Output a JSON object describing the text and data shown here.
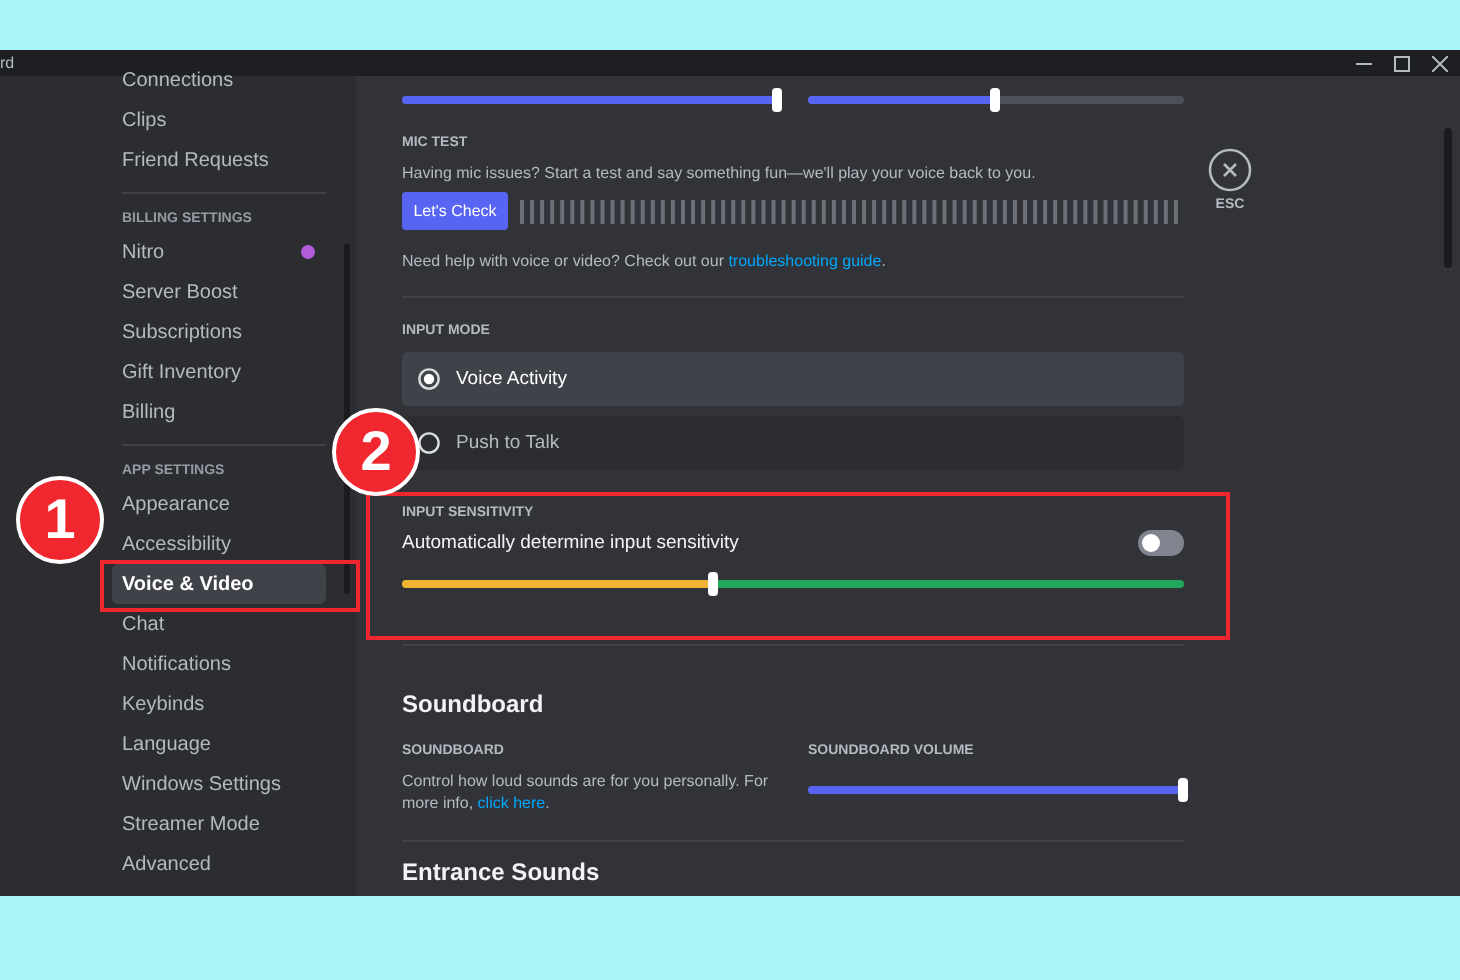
{
  "window": {
    "title": "rd"
  },
  "sidebar": {
    "sections": [
      {
        "items": [
          {
            "label": "Connections",
            "selected": false
          },
          {
            "label": "Clips",
            "selected": false
          },
          {
            "label": "Friend Requests",
            "selected": false
          }
        ]
      },
      {
        "header": "BILLING SETTINGS",
        "items": [
          {
            "label": "Nitro",
            "selected": false,
            "badge": true
          },
          {
            "label": "Server Boost",
            "selected": false
          },
          {
            "label": "Subscriptions",
            "selected": false
          },
          {
            "label": "Gift Inventory",
            "selected": false
          },
          {
            "label": "Billing",
            "selected": false
          }
        ]
      },
      {
        "header": "APP SETTINGS",
        "items": [
          {
            "label": "Appearance",
            "selected": false
          },
          {
            "label": "Accessibility",
            "selected": false
          },
          {
            "label": "Voice & Video",
            "selected": true
          },
          {
            "label": "Chat",
            "selected": false
          },
          {
            "label": "Notifications",
            "selected": false
          },
          {
            "label": "Keybinds",
            "selected": false
          },
          {
            "label": "Language",
            "selected": false
          },
          {
            "label": "Windows Settings",
            "selected": false
          },
          {
            "label": "Streamer Mode",
            "selected": false
          },
          {
            "label": "Advanced",
            "selected": false
          }
        ]
      }
    ]
  },
  "content": {
    "top_sliders": [
      {
        "level": 1
      },
      {
        "level": 0.5
      }
    ],
    "mic_test": {
      "heading": "MIC TEST",
      "description": "Having mic issues? Start a test and say something fun—we'll play your voice back to you.",
      "button": "Let's Check",
      "help_text": "Need help with voice or video? Check out our ",
      "help_link": "troubleshooting guide",
      "help_end": "."
    },
    "input_mode": {
      "heading": "INPUT MODE",
      "options": [
        {
          "label": "Voice Activity",
          "selected": true
        },
        {
          "label": "Push to Talk",
          "selected": false
        }
      ]
    },
    "input_sensitivity": {
      "heading": "INPUT SENSITIVITY",
      "label": "Automatically determine input sensitivity",
      "on": false,
      "level": 0.4
    },
    "soundboard": {
      "title": "Soundboard",
      "heading": "SOUNDBOARD",
      "description": "Control how loud sounds are for you personally. For more info, ",
      "link": "click here",
      "end": ".",
      "volume": {
        "heading": "SOUNDBOARD VOLUME",
        "level": 1
      }
    },
    "entrance_sounds_title": "Entrance Sounds"
  },
  "close_button": {
    "label": "ESC"
  },
  "annotations": [
    {
      "label": "1"
    },
    {
      "label": "2"
    }
  ]
}
